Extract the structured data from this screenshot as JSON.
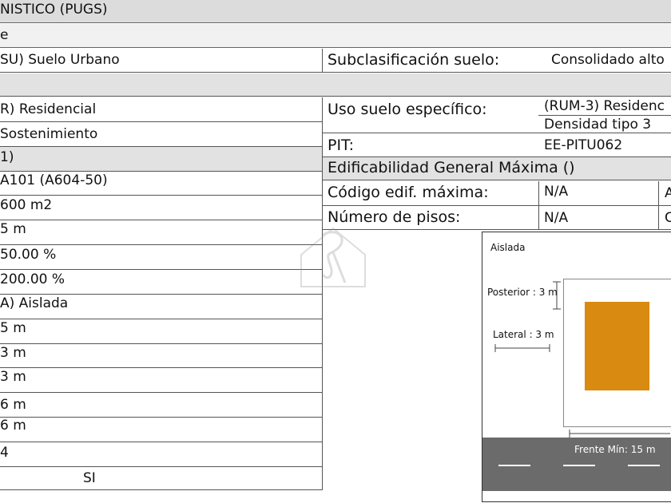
{
  "header": {
    "title": "NÍSTICO (PUGS)",
    "row2": "e"
  },
  "left_rows": [
    "SU) Suelo Urbano",
    "R) Residencial",
    "Sostenimiento",
    "1)",
    "A101 (A604-50)",
    "600 m2",
    "5 m",
    "50.00 %",
    "200.00 %",
    "A) Aislada",
    "5 m",
    "3 m",
    "3 m",
    "6 m",
    "6 m",
    "4",
    "SI"
  ],
  "right": {
    "subclasificacion_label": "Subclasificación suelo:",
    "subclasificacion_value": "Consolidado alto",
    "uso_label": "Uso suelo específico:",
    "uso_value_1": "(RUM-3) Residenc",
    "uso_value_2": "Densidad tipo 3",
    "pit_label": "PIT:",
    "pit_value": "EE-PITU062",
    "edif_header": "Edificabilidad General Máxima ()",
    "codigo_label": "Código edif. máxima:",
    "codigo_value": "N/A",
    "codigo_extra": "A",
    "pisos_label": "Número de pisos:",
    "pisos_value": "N/A",
    "pisos_extra": "C"
  },
  "diagram": {
    "title": "Aislada",
    "posterior": "Posterior : 3 m",
    "lateral": "Lateral : 3 m",
    "frente": "Frente Mín: 15 m",
    "building_color": "#d98a10",
    "road_color": "#6b6b6b"
  }
}
